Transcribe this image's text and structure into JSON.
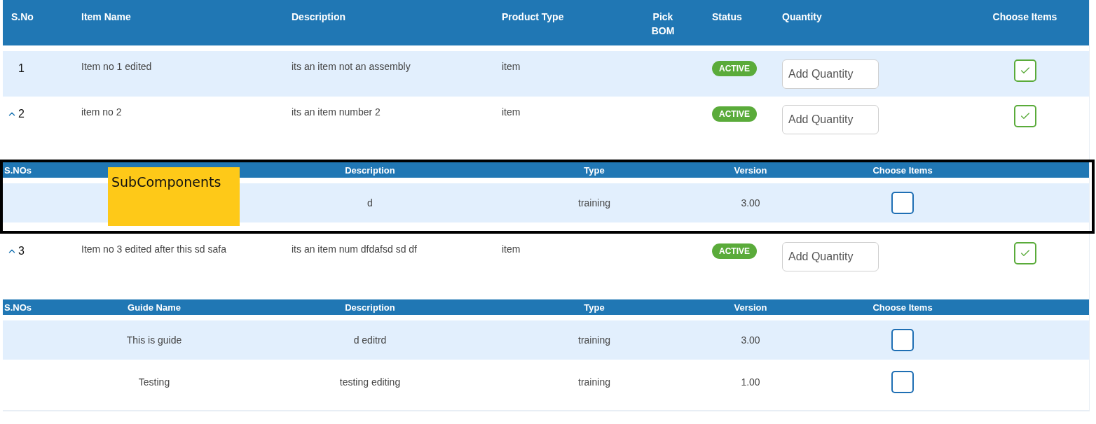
{
  "table": {
    "columns": [
      "S.No",
      "Item Name",
      "Description",
      "Product Type",
      "Pick BOM",
      "Status",
      "Quantity",
      "Choose Items"
    ],
    "rows": [
      {
        "s_no": "1",
        "item_name": "Item no 1 edited",
        "description": "its an item not an assembly",
        "product_type": "item",
        "status": "ACTIVE",
        "quantity_placeholder": "Add Quantity",
        "selected": true,
        "expanded": false
      },
      {
        "s_no": "2",
        "item_name": "item no 2",
        "description": "its an item number 2",
        "product_type": "item",
        "status": "ACTIVE",
        "quantity_placeholder": "Add Quantity",
        "selected": true,
        "expanded": true,
        "note": "SubComponents",
        "subcomponents": {
          "highlighted": true,
          "headers": {
            "s_no": "S.NOs",
            "description": "Description",
            "type": "Type",
            "version": "Version",
            "choose": "Choose Items"
          },
          "rows": [
            {
              "description": "d",
              "type": "training",
              "version": "3.00",
              "selected": false
            }
          ]
        }
      },
      {
        "s_no": "3",
        "item_name": "Item no 3 edited after this sd safa",
        "description": "its an item num dfdafsd sd df",
        "product_type": "item",
        "status": "ACTIVE",
        "quantity_placeholder": "Add Quantity",
        "selected": true,
        "expanded": true,
        "subcomponents": {
          "highlighted": false,
          "headers": {
            "s_no": "S.NOs",
            "guide_name": "Guide Name",
            "description": "Description",
            "type": "Type",
            "version": "Version",
            "choose": "Choose Items"
          },
          "rows": [
            {
              "guide_name": "This is guide",
              "description": "d editrd",
              "type": "training",
              "version": "3.00",
              "selected": false
            },
            {
              "guide_name": "Testing",
              "description": "testing editing",
              "type": "training",
              "version": "1.00",
              "selected": false
            }
          ]
        }
      }
    ]
  }
}
